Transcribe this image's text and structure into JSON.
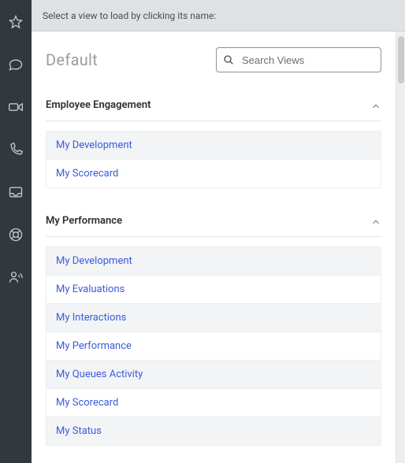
{
  "topbar": {
    "instruction": "Select a view to load by clicking its name:"
  },
  "header": {
    "title": "Default"
  },
  "search": {
    "placeholder": "Search Views"
  },
  "nav": [
    {
      "name": "star-icon"
    },
    {
      "name": "chat-icon"
    },
    {
      "name": "video-icon"
    },
    {
      "name": "phone-icon"
    },
    {
      "name": "inbox-icon"
    },
    {
      "name": "lifebuoy-icon"
    },
    {
      "name": "person-signal-icon"
    }
  ],
  "groups": [
    {
      "title": "Employee Engagement",
      "items": [
        "My Development",
        "My Scorecard"
      ]
    },
    {
      "title": "My Performance",
      "items": [
        "My Development",
        "My Evaluations",
        "My Interactions",
        "My Performance",
        "My Queues Activity",
        "My Scorecard",
        "My Status"
      ]
    }
  ]
}
